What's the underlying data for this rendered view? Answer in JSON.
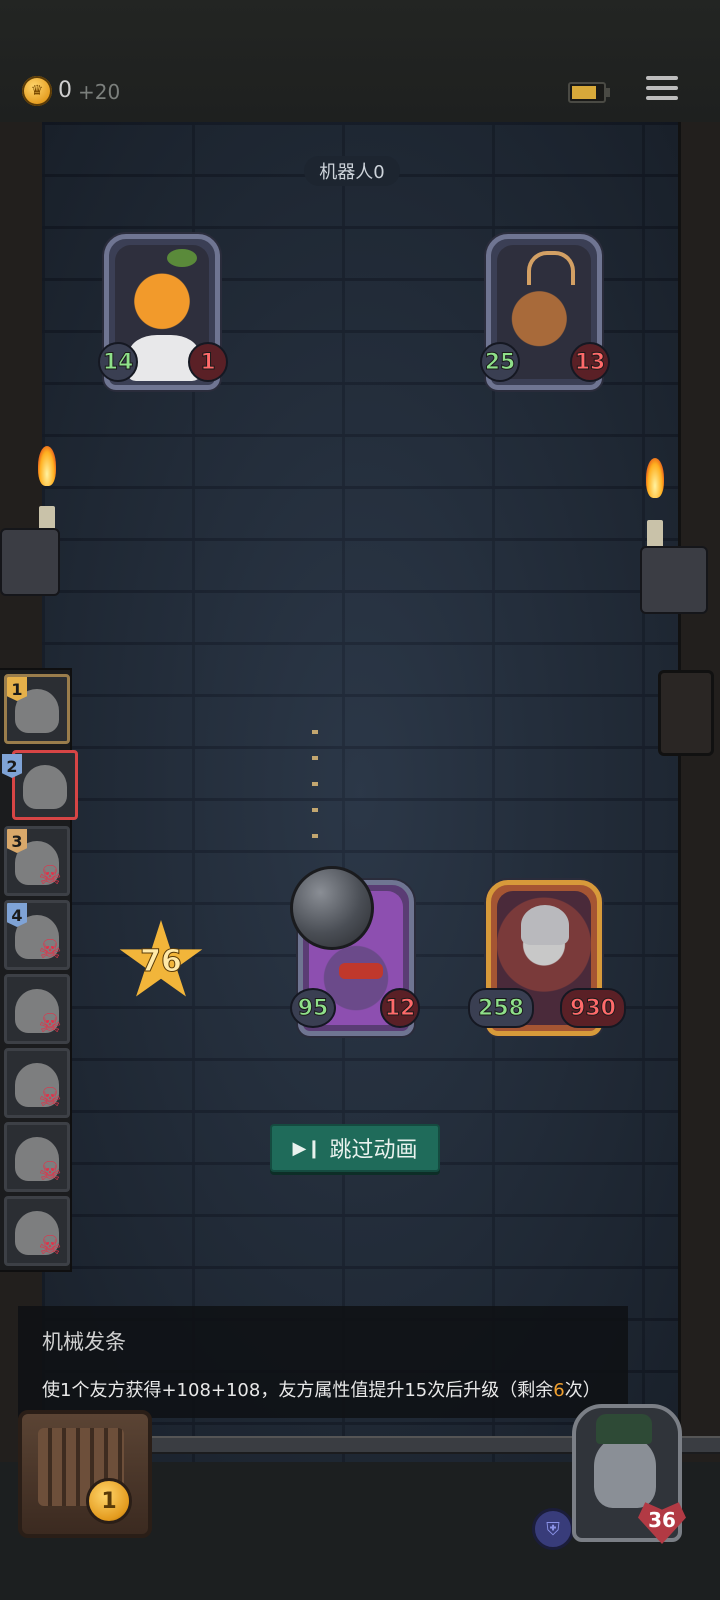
{
  "topbar": {
    "coins": "0",
    "coin_gain": "+20",
    "coin_icon": "crown-coin-icon",
    "battery_icon": "battery-icon",
    "menu_icon": "menu-icon"
  },
  "opponent": {
    "label": "机器人0",
    "cards": [
      {
        "name": "pumpkin",
        "attack": "14",
        "health": "1"
      },
      {
        "name": "reindeer",
        "attack": "25",
        "health": "13"
      }
    ]
  },
  "player_board": {
    "cards": [
      {
        "name": "purple-gremlin",
        "attack": "95",
        "health": "12"
      },
      {
        "name": "armored-knight",
        "attack": "258",
        "health": "930"
      }
    ],
    "damage_star": "76"
  },
  "queue": [
    {
      "num": "1",
      "dead": false
    },
    {
      "num": "2",
      "dead": false
    },
    {
      "num": "3",
      "dead": true
    },
    {
      "num": "4",
      "dead": true
    },
    {
      "num": "",
      "dead": true
    },
    {
      "num": "",
      "dead": true
    },
    {
      "num": "",
      "dead": true
    },
    {
      "num": "",
      "dead": true
    }
  ],
  "skip_button": {
    "label": "跳过动画"
  },
  "tooltip": {
    "title": "机械发条",
    "desc_prefix": "使1个友方获得+108+108，友方属性值提升15次后升级（剩余",
    "desc_highlight": "6",
    "desc_suffix": "次）"
  },
  "shop": {
    "level": "1"
  },
  "hero": {
    "health": "36"
  }
}
